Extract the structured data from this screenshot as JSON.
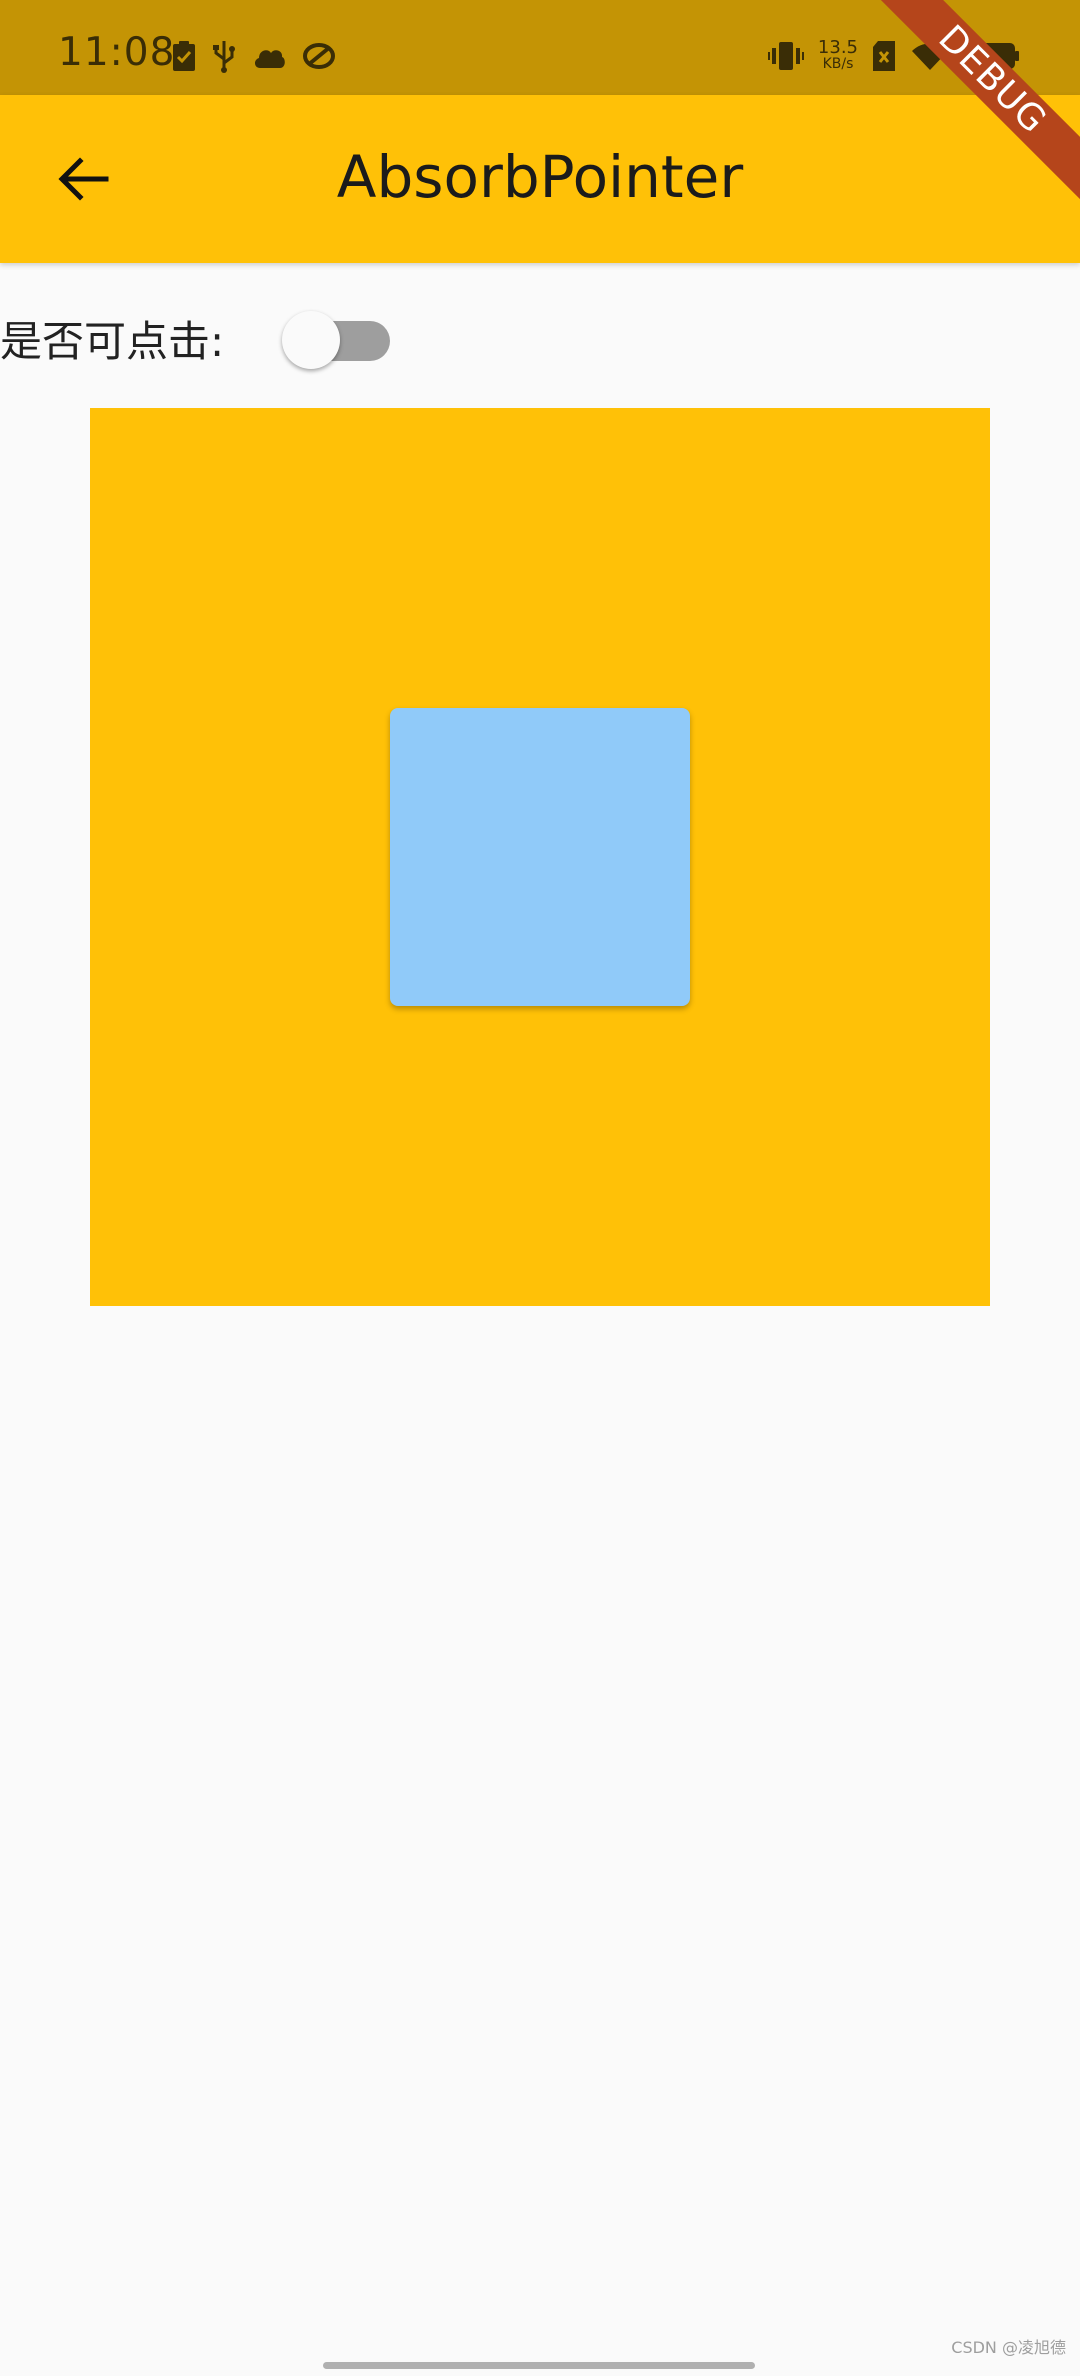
{
  "status_bar": {
    "time": "11:08",
    "net_speed_value": "13.5",
    "net_speed_unit": "KB/s",
    "icons_left": [
      "clipboard-check-icon",
      "usb-icon",
      "cloud-icon",
      "sync-icon"
    ],
    "icons_right": [
      "vibrate-icon",
      "sim-no-signal-icon",
      "wifi-icon",
      "battery-icon"
    ]
  },
  "app_bar": {
    "title": "AbsorbPointer",
    "back_icon": "arrow-back-icon",
    "background": "#ffc107"
  },
  "debug_banner": {
    "label": "DEBUG"
  },
  "toggle": {
    "label": "是否可点击:",
    "state": "off"
  },
  "boxes": {
    "outer_color": "#ffc107",
    "inner_color": "#90caf9"
  },
  "watermark": "CSDN @凌旭德"
}
